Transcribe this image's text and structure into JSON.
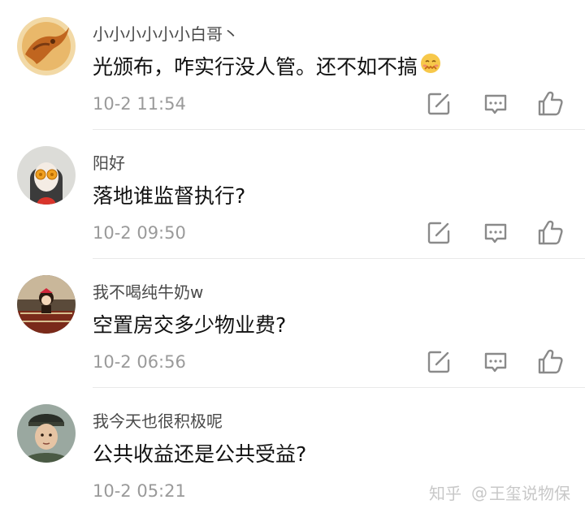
{
  "comments": [
    {
      "username": "小小小小小小白哥丶",
      "text": "光颁布，咋实行没人管。还不如不搞",
      "emoji": "embarrassed-face",
      "time": "10-2 11:54"
    },
    {
      "username": "阳好",
      "text": "落地谁监督执行?",
      "time": "10-2 09:50"
    },
    {
      "username": "我不喝纯牛奶w",
      "text": "空置房交多少物业费?",
      "time": "10-2 06:56"
    },
    {
      "username": "我今天也很积极呢",
      "text": "公共收益还是公共受益?",
      "time": "10-2 05:21"
    }
  ],
  "watermark": {
    "site": "知乎",
    "at": "@",
    "author": "王玺说物保"
  },
  "colors": {
    "username": "#4a4a4a",
    "text": "#111111",
    "time": "#9a9a9a",
    "icon": "#8a8a8a",
    "divider": "#e9e9e9"
  },
  "icons": [
    "reply-icon",
    "comment-icon",
    "like-icon"
  ]
}
